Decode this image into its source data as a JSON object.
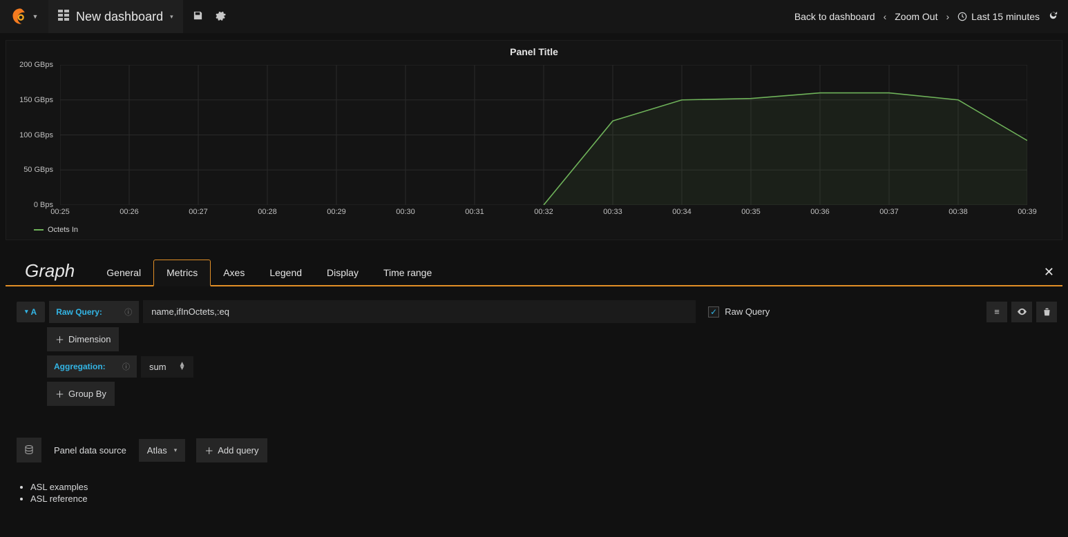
{
  "header": {
    "dashboard_name": "New dashboard",
    "back_link": "Back to dashboard",
    "zoom_out": "Zoom Out",
    "time_range": "Last 15 minutes"
  },
  "panel": {
    "title": "Panel Title",
    "legend_label": "Octets In"
  },
  "chart_data": {
    "type": "line",
    "title": "Panel Title",
    "xlabel": "",
    "ylabel": "",
    "x_ticks": [
      "00:25",
      "00:26",
      "00:27",
      "00:28",
      "00:29",
      "00:30",
      "00:31",
      "00:32",
      "00:33",
      "00:34",
      "00:35",
      "00:36",
      "00:37",
      "00:38",
      "00:39"
    ],
    "y_ticks": [
      "0 Bps",
      "50 GBps",
      "100 GBps",
      "150 GBps",
      "200 GBps"
    ],
    "ylim": [
      0,
      200
    ],
    "series": [
      {
        "name": "Octets In",
        "color": "#6fb35a",
        "x": [
          "00:32",
          "00:33",
          "00:34",
          "00:35",
          "00:36",
          "00:37",
          "00:38",
          "00:39"
        ],
        "y": [
          0,
          120,
          150,
          152,
          160,
          160,
          150,
          92
        ]
      }
    ]
  },
  "editor": {
    "type_label": "Graph",
    "tabs": [
      "General",
      "Metrics",
      "Axes",
      "Legend",
      "Display",
      "Time range"
    ],
    "active_tab": "Metrics"
  },
  "query": {
    "letter": "A",
    "raw_query_label": "Raw Query:",
    "raw_query_value": "name,ifInOctets,:eq",
    "raw_query_checkbox_label": "Raw Query",
    "dimension_btn": "Dimension",
    "aggregation_label": "Aggregation:",
    "aggregation_value": "sum",
    "groupby_btn": "Group By"
  },
  "datasource": {
    "label": "Panel data source",
    "value": "Atlas",
    "add_query": "Add query"
  },
  "links": {
    "items": [
      "ASL examples",
      "ASL reference"
    ]
  }
}
